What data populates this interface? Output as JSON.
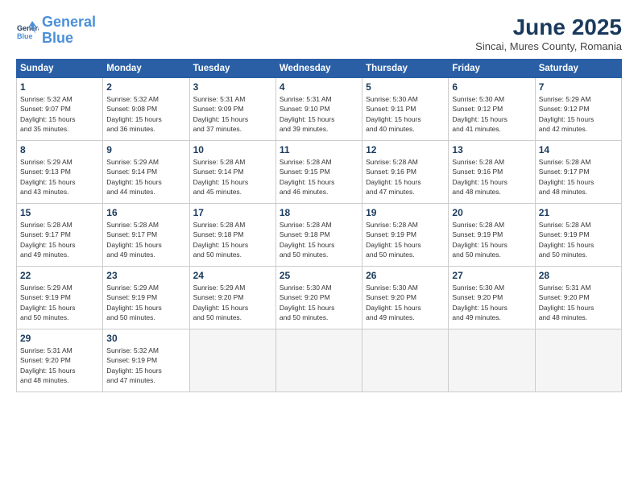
{
  "logo": {
    "line1": "General",
    "line2": "Blue"
  },
  "title": "June 2025",
  "subtitle": "Sincai, Mures County, Romania",
  "headers": [
    "Sunday",
    "Monday",
    "Tuesday",
    "Wednesday",
    "Thursday",
    "Friday",
    "Saturday"
  ],
  "weeks": [
    [
      {
        "day": "1",
        "rise": "5:32 AM",
        "set": "9:07 PM",
        "hours": "15",
        "mins": "35"
      },
      {
        "day": "2",
        "rise": "5:32 AM",
        "set": "9:08 PM",
        "hours": "15",
        "mins": "36"
      },
      {
        "day": "3",
        "rise": "5:31 AM",
        "set": "9:09 PM",
        "hours": "15",
        "mins": "37"
      },
      {
        "day": "4",
        "rise": "5:31 AM",
        "set": "9:10 PM",
        "hours": "15",
        "mins": "39"
      },
      {
        "day": "5",
        "rise": "5:30 AM",
        "set": "9:11 PM",
        "hours": "15",
        "mins": "40"
      },
      {
        "day": "6",
        "rise": "5:30 AM",
        "set": "9:12 PM",
        "hours": "15",
        "mins": "41"
      },
      {
        "day": "7",
        "rise": "5:29 AM",
        "set": "9:12 PM",
        "hours": "15",
        "mins": "42"
      }
    ],
    [
      {
        "day": "8",
        "rise": "5:29 AM",
        "set": "9:13 PM",
        "hours": "15",
        "mins": "43"
      },
      {
        "day": "9",
        "rise": "5:29 AM",
        "set": "9:14 PM",
        "hours": "15",
        "mins": "44"
      },
      {
        "day": "10",
        "rise": "5:28 AM",
        "set": "9:14 PM",
        "hours": "15",
        "mins": "45"
      },
      {
        "day": "11",
        "rise": "5:28 AM",
        "set": "9:15 PM",
        "hours": "15",
        "mins": "46"
      },
      {
        "day": "12",
        "rise": "5:28 AM",
        "set": "9:16 PM",
        "hours": "15",
        "mins": "47"
      },
      {
        "day": "13",
        "rise": "5:28 AM",
        "set": "9:16 PM",
        "hours": "15",
        "mins": "48"
      },
      {
        "day": "14",
        "rise": "5:28 AM",
        "set": "9:17 PM",
        "hours": "15",
        "mins": "48"
      }
    ],
    [
      {
        "day": "15",
        "rise": "5:28 AM",
        "set": "9:17 PM",
        "hours": "15",
        "mins": "49"
      },
      {
        "day": "16",
        "rise": "5:28 AM",
        "set": "9:17 PM",
        "hours": "15",
        "mins": "49"
      },
      {
        "day": "17",
        "rise": "5:28 AM",
        "set": "9:18 PM",
        "hours": "15",
        "mins": "50"
      },
      {
        "day": "18",
        "rise": "5:28 AM",
        "set": "9:18 PM",
        "hours": "15",
        "mins": "50"
      },
      {
        "day": "19",
        "rise": "5:28 AM",
        "set": "9:19 PM",
        "hours": "15",
        "mins": "50"
      },
      {
        "day": "20",
        "rise": "5:28 AM",
        "set": "9:19 PM",
        "hours": "15",
        "mins": "50"
      },
      {
        "day": "21",
        "rise": "5:28 AM",
        "set": "9:19 PM",
        "hours": "15",
        "mins": "50"
      }
    ],
    [
      {
        "day": "22",
        "rise": "5:29 AM",
        "set": "9:19 PM",
        "hours": "15",
        "mins": "50"
      },
      {
        "day": "23",
        "rise": "5:29 AM",
        "set": "9:19 PM",
        "hours": "15",
        "mins": "50"
      },
      {
        "day": "24",
        "rise": "5:29 AM",
        "set": "9:20 PM",
        "hours": "15",
        "mins": "50"
      },
      {
        "day": "25",
        "rise": "5:30 AM",
        "set": "9:20 PM",
        "hours": "15",
        "mins": "50"
      },
      {
        "day": "26",
        "rise": "5:30 AM",
        "set": "9:20 PM",
        "hours": "15",
        "mins": "49"
      },
      {
        "day": "27",
        "rise": "5:30 AM",
        "set": "9:20 PM",
        "hours": "15",
        "mins": "49"
      },
      {
        "day": "28",
        "rise": "5:31 AM",
        "set": "9:20 PM",
        "hours": "15",
        "mins": "48"
      }
    ],
    [
      {
        "day": "29",
        "rise": "5:31 AM",
        "set": "9:20 PM",
        "hours": "15",
        "mins": "48"
      },
      {
        "day": "30",
        "rise": "5:32 AM",
        "set": "9:19 PM",
        "hours": "15",
        "mins": "47"
      },
      null,
      null,
      null,
      null,
      null
    ]
  ]
}
